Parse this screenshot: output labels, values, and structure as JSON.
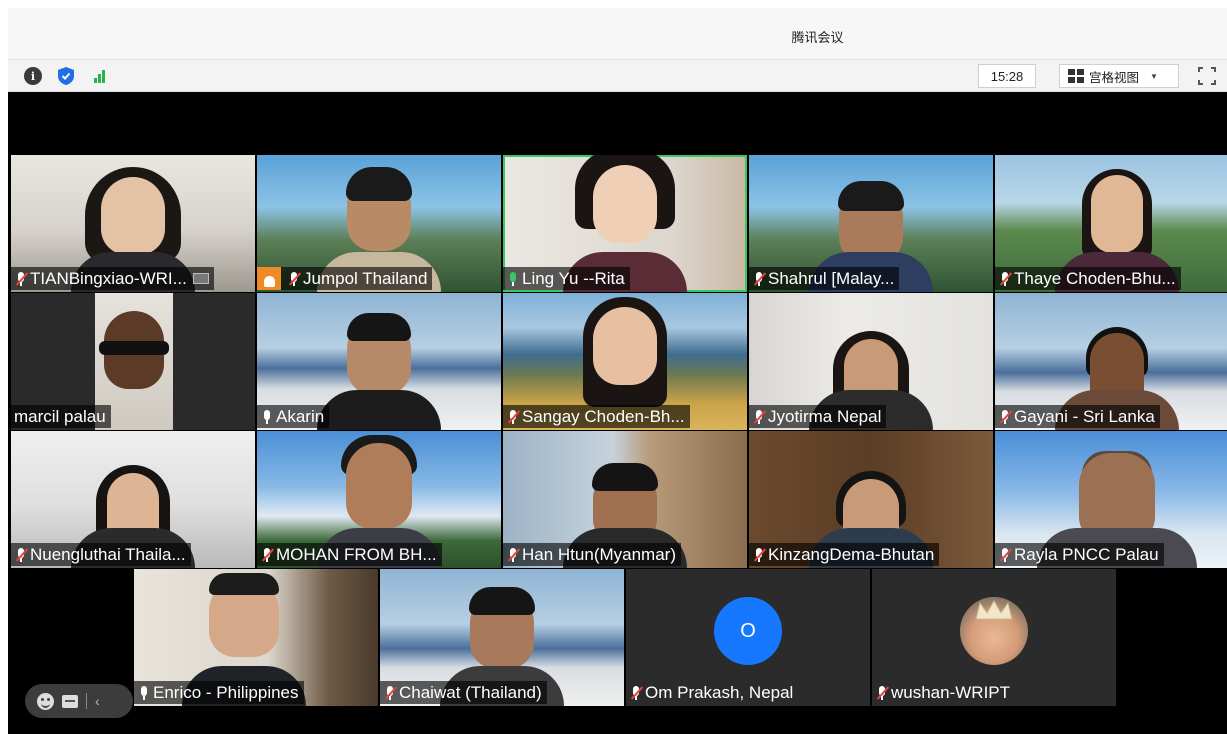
{
  "window": {
    "title": "腾讯会议"
  },
  "toolbar": {
    "info_glyph": "i",
    "clock": "15:28",
    "view_label": "宫格视图",
    "caret_glyph": "▼"
  },
  "icons": {
    "info": "info-icon",
    "security": "shield-icon",
    "network": "signal-bars-icon",
    "view": "grid-view-icon",
    "fullscreen": "fullscreen-icon",
    "mic": "microphone-icon",
    "cohost": "person-badge-icon",
    "emoji": "emoji-icon",
    "chat": "chat-icon",
    "collapse": "chevron-left-icon"
  },
  "colors": {
    "muted": "#e8433f",
    "speaking": "#37c864",
    "cohost_badge": "#f08a24",
    "avatar_o": "#1677ff"
  },
  "participants": [
    {
      "name": "TIANBingxiao-WRI...",
      "mic": "muted"
    },
    {
      "name": "Jumpol  Thailand",
      "mic": "muted",
      "badge": "cohost"
    },
    {
      "name": "Ling Yu --Rita",
      "mic": "active",
      "speaking": true
    },
    {
      "name": "Shahrul [Malay...",
      "mic": "muted"
    },
    {
      "name": "Thaye Choden-Bhu...",
      "mic": "muted"
    },
    {
      "name": "marcil palau",
      "mic": "none"
    },
    {
      "name": "Akarin",
      "mic": "on"
    },
    {
      "name": "Sangay Choden-Bh...",
      "mic": "muted"
    },
    {
      "name": "Jyotirma Nepal",
      "mic": "muted"
    },
    {
      "name": "Gayani - Sri Lanka",
      "mic": "muted"
    },
    {
      "name": "Nuengluthai Thaila...",
      "mic": "muted"
    },
    {
      "name": "MOHAN FROM BH...",
      "mic": "muted"
    },
    {
      "name": "Han Htun(Myanmar)",
      "mic": "muted"
    },
    {
      "name": "KinzangDema-Bhutan",
      "mic": "muted"
    },
    {
      "name": "Rayla PNCC Palau",
      "mic": "muted"
    },
    {
      "name": "Enrico - Philippines",
      "mic": "on"
    },
    {
      "name": "Chaiwat  (Thailand)",
      "mic": "muted"
    },
    {
      "name": "Om Prakash, Nepal",
      "mic": "muted",
      "avatar_letter": "O"
    },
    {
      "name": "wushan-WRIPT",
      "mic": "muted"
    }
  ],
  "float_bar": {
    "collapse_glyph": "‹"
  }
}
